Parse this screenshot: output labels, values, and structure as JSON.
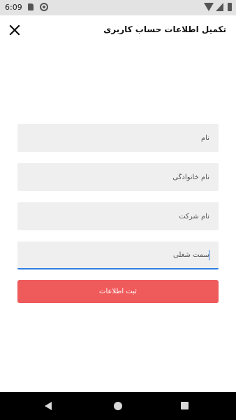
{
  "status_bar": {
    "time": "6:09"
  },
  "app_bar": {
    "title": "تکمیل اطلاعات حساب کاربری"
  },
  "form": {
    "fields": [
      {
        "placeholder": "نام"
      },
      {
        "placeholder": "نام خانوادگی"
      },
      {
        "placeholder": "نام شرکت"
      },
      {
        "placeholder": "سمت شغلی"
      }
    ],
    "submit_label": "ثبت اطلاعات"
  },
  "colors": {
    "accent": "#ef5a5b",
    "focus": "#2f7de1",
    "field_background": "#efefef",
    "status_bar": "#e3e3e3",
    "nav_bar": "#000000"
  },
  "icons": {
    "status_bar": [
      "sim-card-icon",
      "data-saver-icon",
      "wifi-icon",
      "cell-signal-icon",
      "battery-icon"
    ],
    "app_bar": [
      "close-icon"
    ],
    "nav_bar": [
      "back-icon",
      "home-icon",
      "recents-icon"
    ]
  }
}
